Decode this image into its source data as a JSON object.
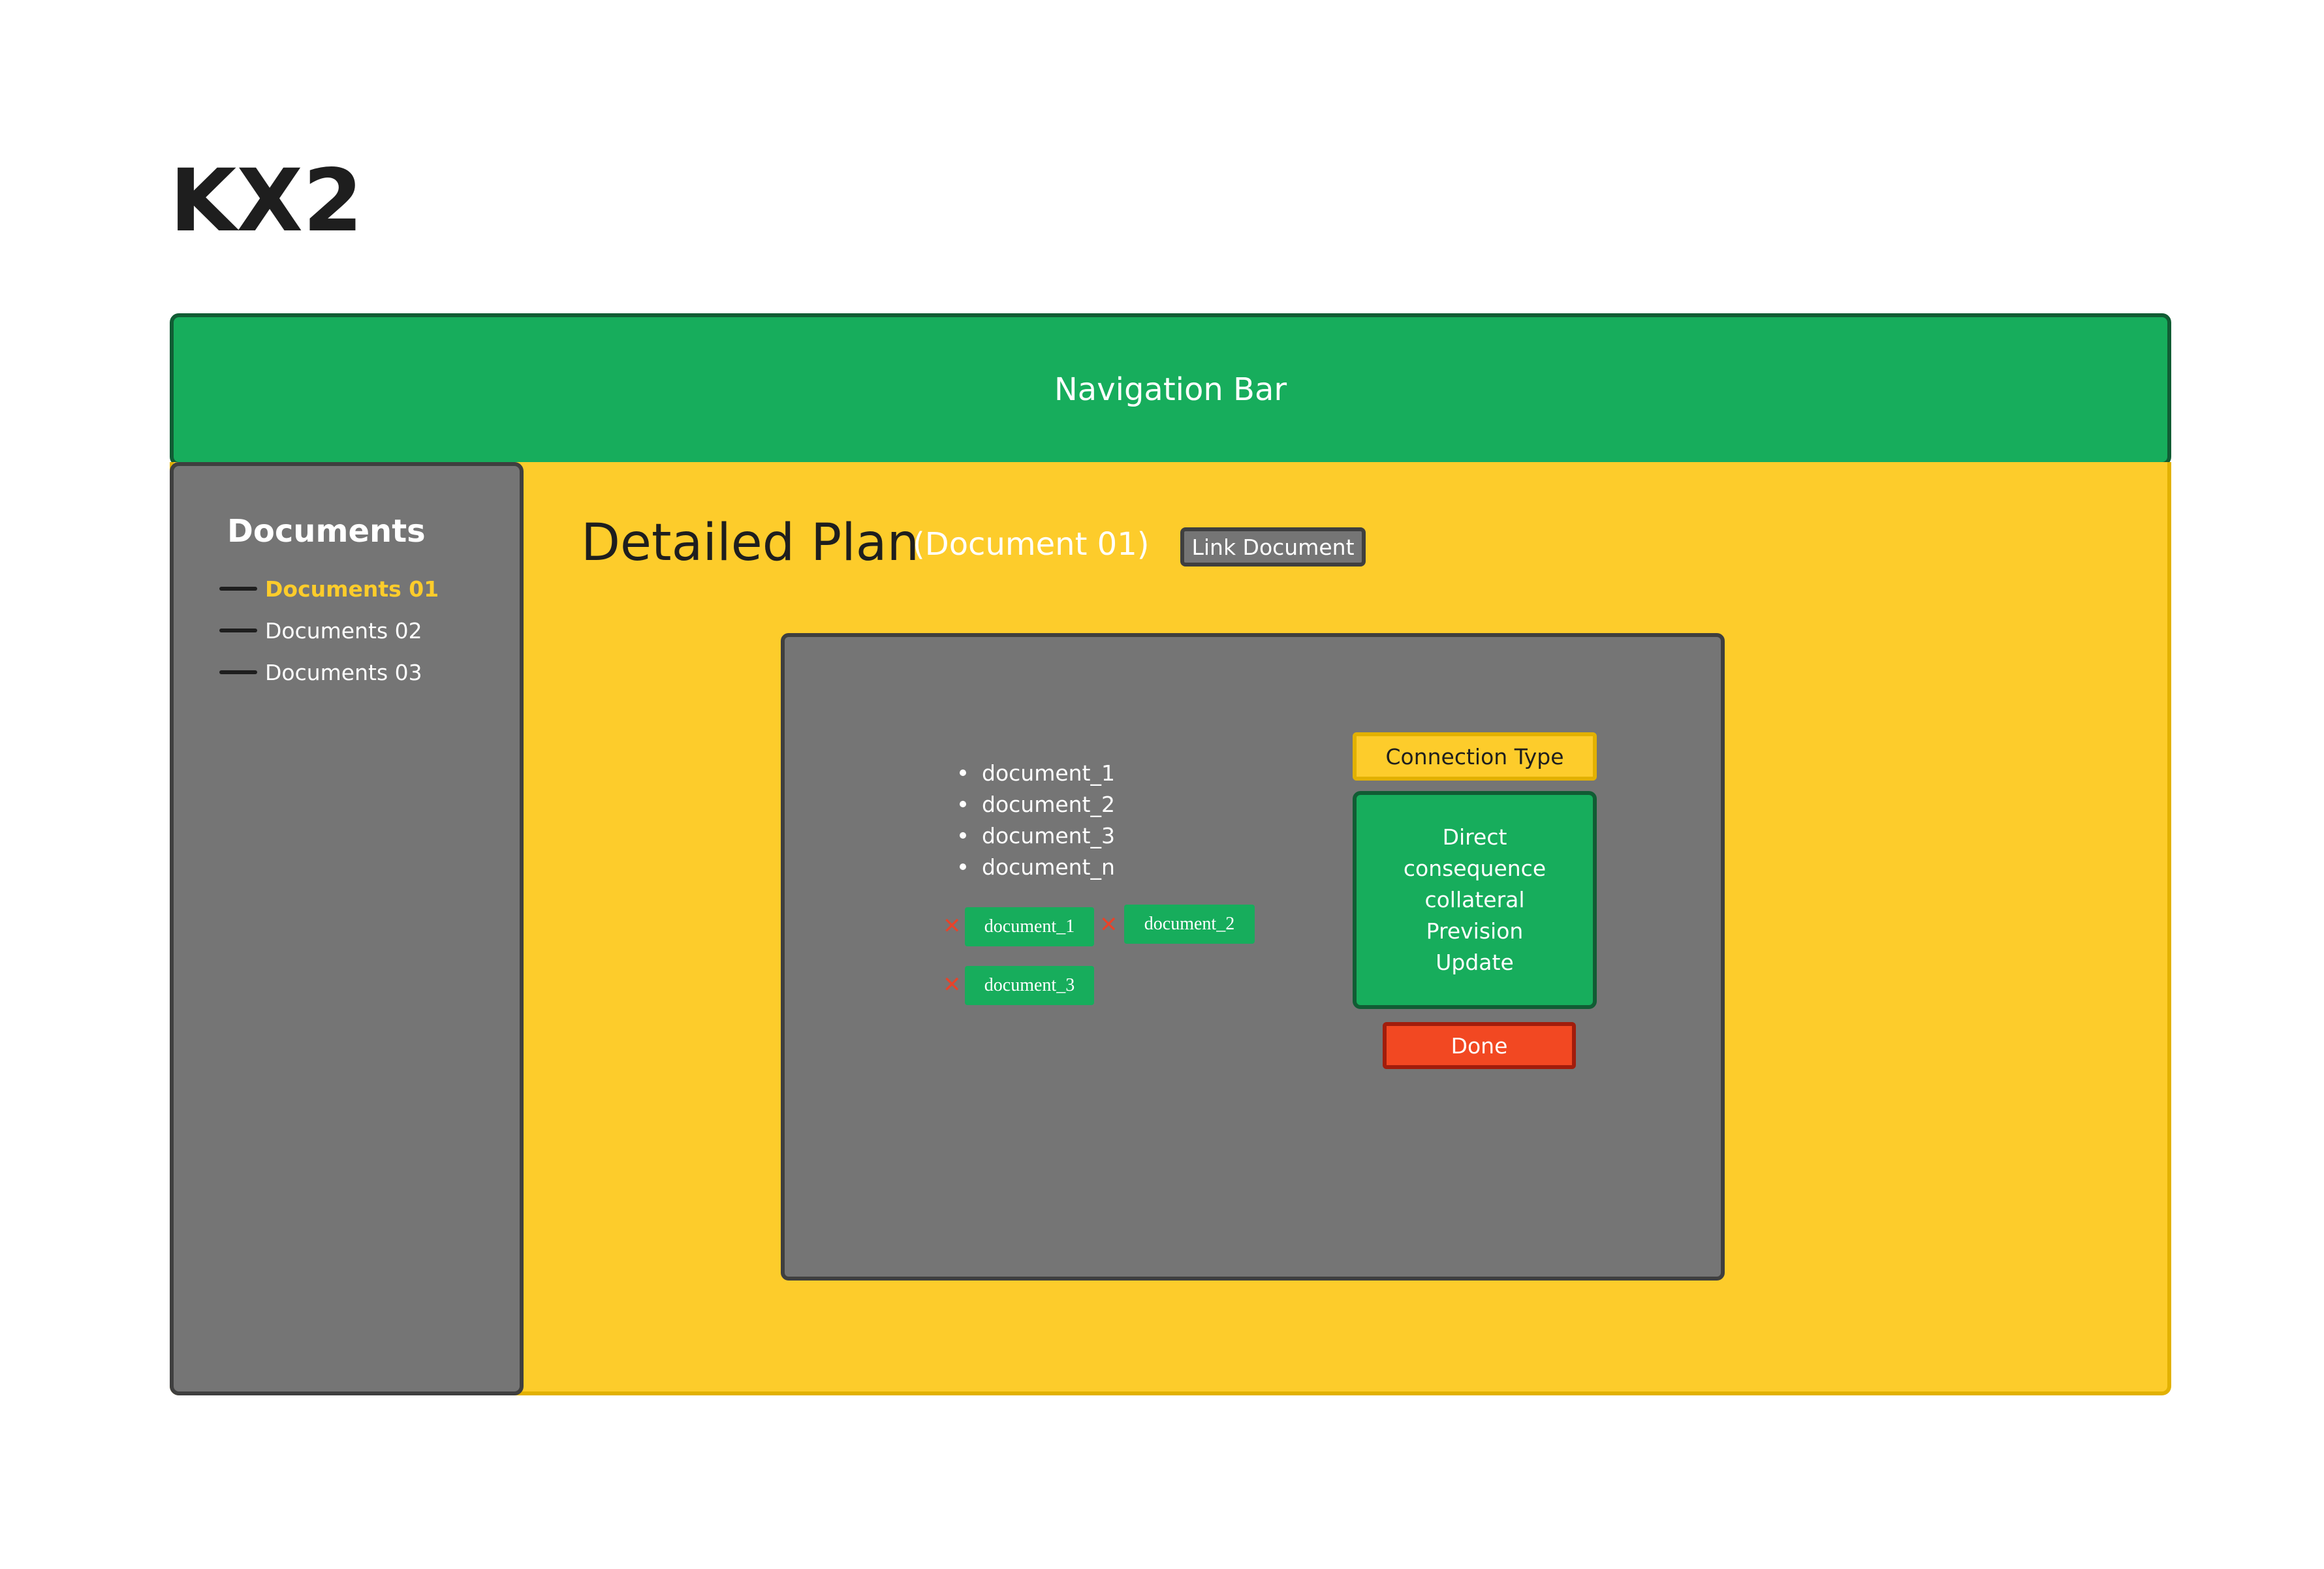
{
  "app": {
    "title": "KX2"
  },
  "navbar": {
    "title": "Navigation Bar"
  },
  "sidebar": {
    "heading": "Documents",
    "items": [
      {
        "label": "Documents 01",
        "active": true
      },
      {
        "label": "Documents 02",
        "active": false
      },
      {
        "label": "Documents 03",
        "active": false
      }
    ]
  },
  "main": {
    "title": "Detailed Plan",
    "subtitle": "(Document 01)",
    "link_button": "Link Document"
  },
  "modal": {
    "documents": [
      "document_1",
      "document_2",
      "document_3",
      "document_n"
    ],
    "selected_chips": [
      "document_1",
      "document_2",
      "document_3"
    ],
    "remove_icon": "close-icon",
    "connection_type_label": "Connection Type",
    "connection_options": [
      "Direct",
      "consequence",
      "collateral",
      "Prevision",
      "Update"
    ],
    "done_button": "Done"
  },
  "colors": {
    "green": "#17ad5c",
    "yellow": "#fdcc2b",
    "gray": "#757575",
    "red": "#f24822",
    "dark": "#1e1e1e"
  }
}
